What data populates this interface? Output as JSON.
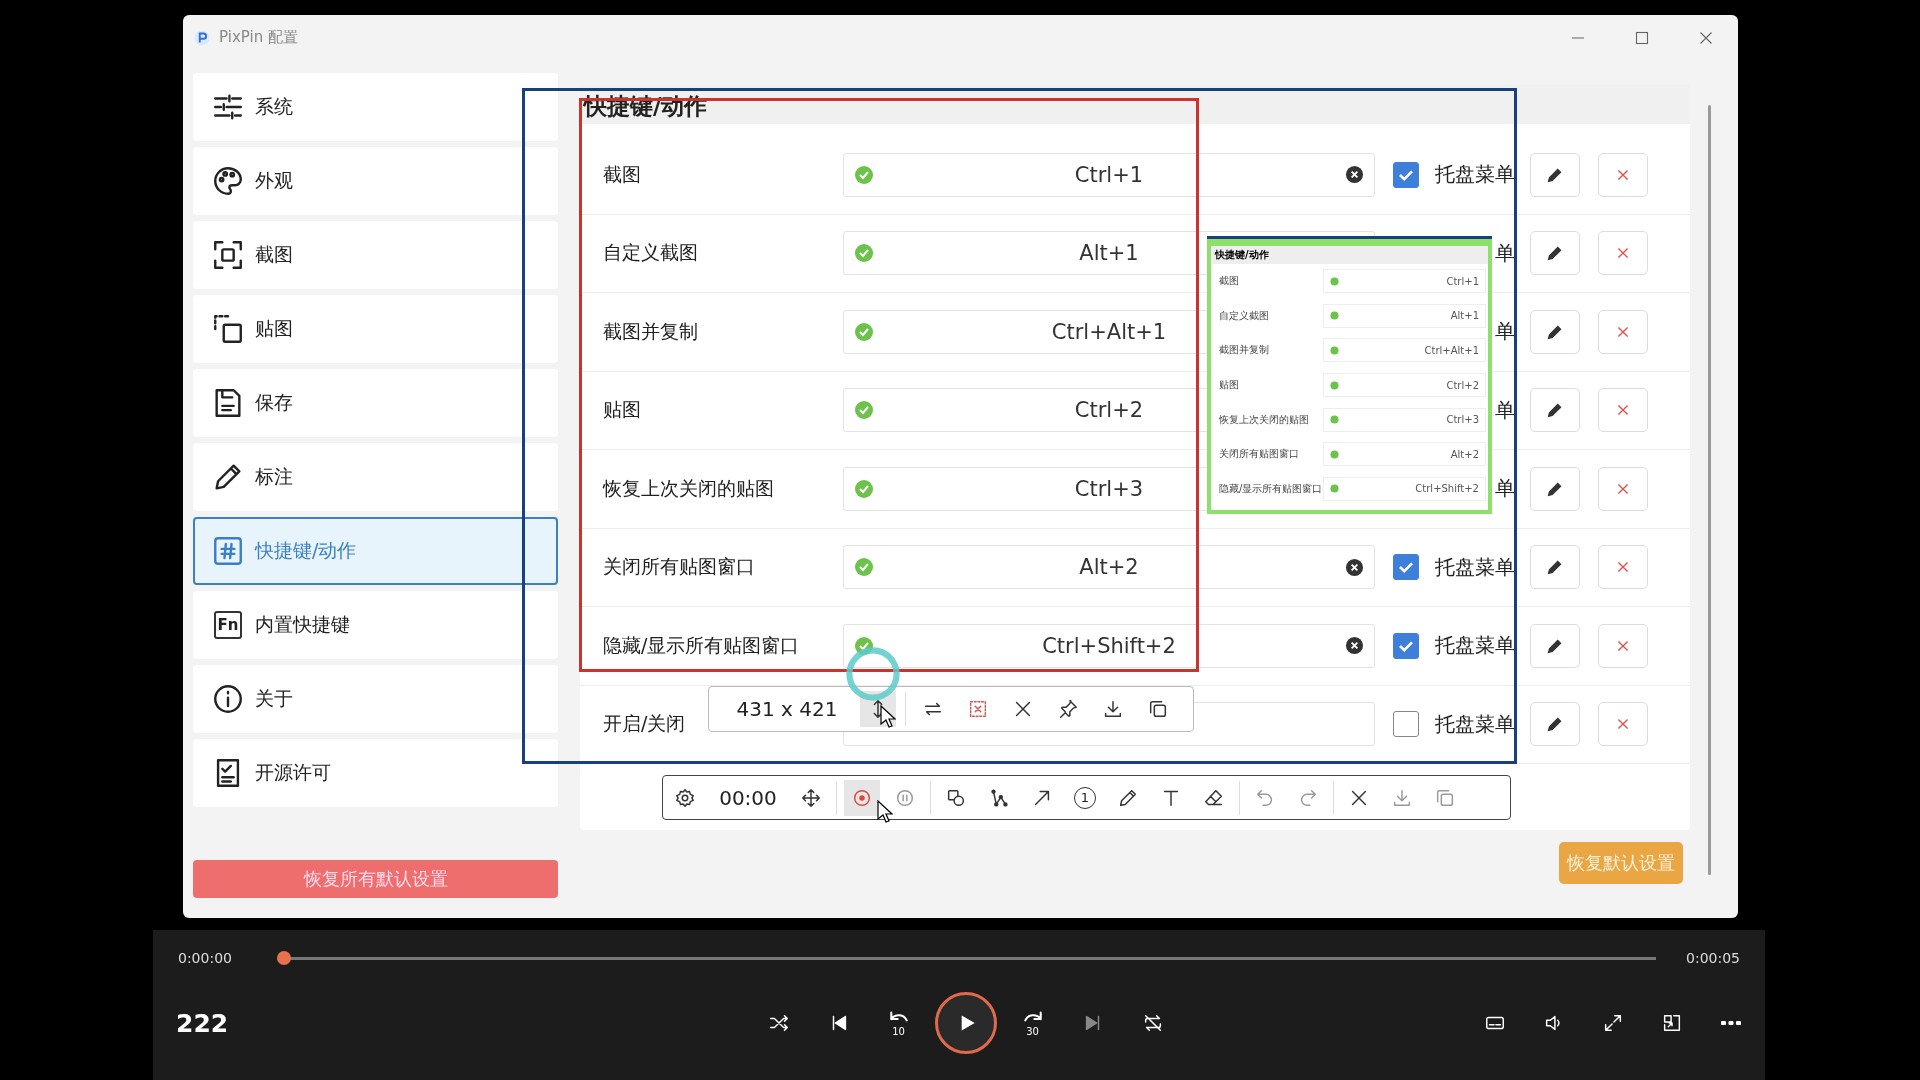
{
  "app": {
    "title": "PixPin 配置",
    "sidebar": [
      {
        "kind": "sliders",
        "label": "系统",
        "selected": false
      },
      {
        "kind": "palette",
        "label": "外观",
        "selected": false
      },
      {
        "kind": "capture",
        "label": "截图",
        "selected": false
      },
      {
        "kind": "pin",
        "label": "贴图",
        "selected": false
      },
      {
        "kind": "save",
        "label": "保存",
        "selected": false
      },
      {
        "kind": "pencil",
        "label": "标注",
        "selected": false
      },
      {
        "kind": "hash",
        "label": "快捷键/动作",
        "selected": true
      },
      {
        "kind": "fn",
        "icon_text": "Fn",
        "label": "内置快捷键",
        "selected": false
      },
      {
        "kind": "info",
        "label": "关于",
        "selected": false
      },
      {
        "kind": "checklist",
        "label": "开源许可",
        "selected": false
      }
    ],
    "reset_all": "恢复所有默认设置",
    "section_title": "快捷键/动作",
    "rows": [
      {
        "label": "截图",
        "key": "Ctrl+1",
        "valid": true,
        "clearable": true,
        "tray_checked": true,
        "tray_label": "托盘菜单"
      },
      {
        "label": "自定义截图",
        "key": "Alt+1",
        "valid": true,
        "tray_label": "单"
      },
      {
        "label": "截图并复制",
        "key": "Ctrl+Alt+1",
        "valid": true,
        "tray_label": "单"
      },
      {
        "label": "贴图",
        "key": "Ctrl+2",
        "valid": true,
        "tray_label": "单"
      },
      {
        "label": "恢复上次关闭的贴图",
        "key": "Ctrl+3",
        "valid": true,
        "tray_label": "单"
      },
      {
        "label": "关闭所有贴图窗口",
        "key": "Alt+2",
        "valid": true,
        "clearable": true,
        "tray_checked": true,
        "tray_label": "托盘菜单"
      },
      {
        "label": "隐藏/显示所有贴图窗口",
        "key": "Ctrl+Shift+2",
        "valid": true,
        "clearable": true,
        "tray_checked": true,
        "tray_label": "托盘菜单"
      },
      {
        "label": "开启/关闭",
        "valid": false,
        "tray_checked": false,
        "tray_label": "托盘菜单"
      }
    ],
    "reset": "恢复默认设置"
  },
  "thumbnail": {
    "title": "快捷键/动作",
    "rows": [
      {
        "label": "截图",
        "key": "Ctrl+1"
      },
      {
        "label": "自定义截图",
        "key": "Alt+1"
      },
      {
        "label": "截图并复制",
        "key": "Ctrl+Alt+1"
      },
      {
        "label": "贴图",
        "key": "Ctrl+2"
      },
      {
        "label": "恢复上次关闭的贴图",
        "key": "Ctrl+3"
      },
      {
        "label": "关闭所有贴图窗口",
        "key": "Alt+2"
      },
      {
        "label": "隐藏/显示所有贴图窗口",
        "key": "Ctrl+Shift+2"
      }
    ]
  },
  "size_toolbar": {
    "size": "431 x 421"
  },
  "record_toolbar": {
    "time": "00:00",
    "step_number": "1"
  },
  "player": {
    "title": "222",
    "elapsed": "0:00:00",
    "total": "0:00:05",
    "level": 0,
    "skip_back": "10",
    "skip_forward": "30"
  }
}
